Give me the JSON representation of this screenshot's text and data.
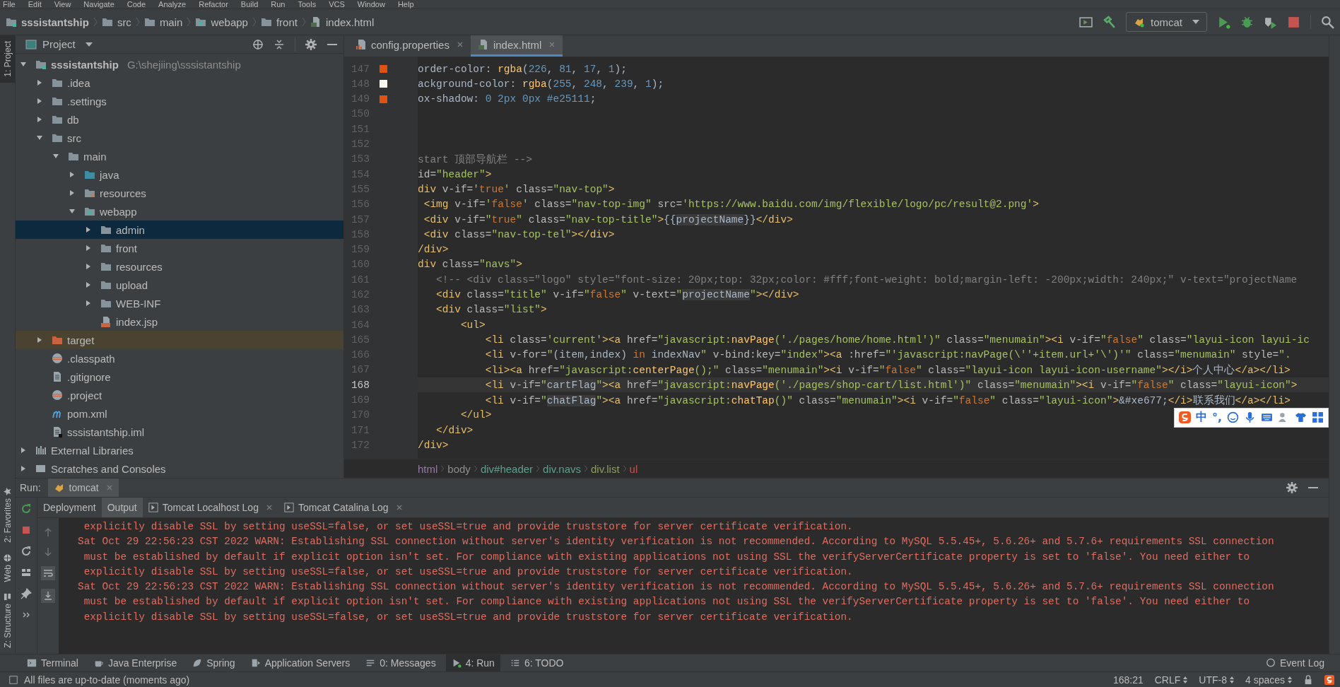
{
  "menu": [
    "File",
    "Edit",
    "View",
    "Navigate",
    "Code",
    "Analyze",
    "Refactor",
    "Build",
    "Run",
    "Tools",
    "VCS",
    "Window",
    "Help"
  ],
  "nav_bar": {
    "crumbs": [
      {
        "label": "sssistantship",
        "kind": "project"
      },
      {
        "label": "src",
        "kind": "folder"
      },
      {
        "label": "main",
        "kind": "folder"
      },
      {
        "label": "webapp",
        "kind": "folder-web"
      },
      {
        "label": "front",
        "kind": "folder"
      },
      {
        "label": "index.html",
        "kind": "file-html"
      }
    ],
    "run_config": "tomcat"
  },
  "side_stripe": {
    "top": [
      {
        "label": "1: Project",
        "selected": true
      }
    ],
    "bottom": [
      {
        "label": "2: Favorites",
        "selected": false,
        "kind": "favorites"
      },
      {
        "label": "Web",
        "selected": false,
        "kind": "web"
      },
      {
        "label": "Z: Structure",
        "selected": false,
        "kind": "structure"
      }
    ]
  },
  "project_panel": {
    "title": "Project",
    "tree": [
      {
        "label": "sssistantship",
        "path": "G:\\shejiing\\sssistantship",
        "kind": "project",
        "expanded": true,
        "selected": false,
        "children": [
          {
            "label": ".idea",
            "kind": "folder",
            "expanded": false,
            "selected": false
          },
          {
            "label": ".settings",
            "kind": "folder",
            "expanded": false,
            "selected": false
          },
          {
            "label": "db",
            "kind": "folder",
            "expanded": false,
            "selected": false
          },
          {
            "label": "src",
            "kind": "folder",
            "expanded": true,
            "selected": false,
            "children": [
              {
                "label": "main",
                "kind": "folder",
                "expanded": true,
                "selected": false,
                "children": [
                  {
                    "label": "java",
                    "kind": "folder-src",
                    "expanded": false,
                    "selected": false
                  },
                  {
                    "label": "resources",
                    "kind": "folder-res",
                    "expanded": false,
                    "selected": false
                  },
                  {
                    "label": "webapp",
                    "kind": "folder-web",
                    "expanded": true,
                    "selected": false,
                    "children": [
                      {
                        "label": "admin",
                        "kind": "folder",
                        "expanded": false,
                        "selected": true
                      },
                      {
                        "label": "front",
                        "kind": "folder",
                        "expanded": false,
                        "selected": false
                      },
                      {
                        "label": "resources",
                        "kind": "folder",
                        "expanded": false,
                        "selected": false
                      },
                      {
                        "label": "upload",
                        "kind": "folder",
                        "expanded": false,
                        "selected": false
                      },
                      {
                        "label": "WEB-INF",
                        "kind": "folder",
                        "expanded": false,
                        "selected": false
                      },
                      {
                        "label": "index.jsp",
                        "kind": "file-jsp",
                        "selected": false
                      }
                    ]
                  }
                ]
              }
            ]
          },
          {
            "label": "target",
            "kind": "folder-excluded",
            "expanded": false,
            "selected": false
          },
          {
            "label": ".classpath",
            "kind": "file-eclipse",
            "selected": false
          },
          {
            "label": ".gitignore",
            "kind": "file-text",
            "selected": false
          },
          {
            "label": ".project",
            "kind": "file-eclipse",
            "selected": false
          },
          {
            "label": "pom.xml",
            "kind": "file-maven",
            "selected": false
          },
          {
            "label": "sssistantship.iml",
            "kind": "file-iml",
            "selected": false
          }
        ]
      },
      {
        "label": "External Libraries",
        "kind": "libraries",
        "expanded": false,
        "selected": false
      },
      {
        "label": "Scratches and Consoles",
        "kind": "scratches",
        "expanded": false,
        "selected": false
      }
    ]
  },
  "editor": {
    "tabs": [
      {
        "label": "config.properties",
        "kind": "properties",
        "selected": false
      },
      {
        "label": "index.html",
        "kind": "html",
        "selected": true
      }
    ],
    "lines": [
      {
        "number": "147",
        "current": false,
        "color": "#e25111",
        "segments": [
          {
            "kind": "plain",
            "text": "order-color: "
          },
          {
            "kind": "fn",
            "text": "rgba"
          },
          {
            "kind": "plain",
            "text": "("
          },
          {
            "kind": "num",
            "text": "226"
          },
          {
            "kind": "plain",
            "text": ", "
          },
          {
            "kind": "num",
            "text": "81"
          },
          {
            "kind": "plain",
            "text": ", "
          },
          {
            "kind": "num",
            "text": "17"
          },
          {
            "kind": "plain",
            "text": ", "
          },
          {
            "kind": "num",
            "text": "1"
          },
          {
            "kind": "plain",
            "text": ");"
          }
        ]
      },
      {
        "number": "148",
        "current": false,
        "color": "#fff8ef",
        "segments": [
          {
            "kind": "plain",
            "text": "ackground-color: "
          },
          {
            "kind": "fn",
            "text": "rgba"
          },
          {
            "kind": "plain",
            "text": "("
          },
          {
            "kind": "num",
            "text": "255"
          },
          {
            "kind": "plain",
            "text": ", "
          },
          {
            "kind": "num",
            "text": "248"
          },
          {
            "kind": "plain",
            "text": ", "
          },
          {
            "kind": "num",
            "text": "239"
          },
          {
            "kind": "plain",
            "text": ", "
          },
          {
            "kind": "num",
            "text": "1"
          },
          {
            "kind": "plain",
            "text": ");"
          }
        ]
      },
      {
        "number": "149",
        "current": false,
        "color": "#e25111",
        "segments": [
          {
            "kind": "plain",
            "text": "ox-shadow: "
          },
          {
            "kind": "num",
            "text": "0 2px 0px #e25111"
          },
          {
            "kind": "plain",
            "text": ";"
          }
        ]
      },
      {
        "number": "150",
        "current": false
      },
      {
        "number": "151",
        "current": false
      },
      {
        "number": "152",
        "current": false
      },
      {
        "number": "153",
        "current": false,
        "segments": [
          {
            "kind": "comment",
            "text": "start 顶部导航栏 -->"
          }
        ]
      },
      {
        "number": "154",
        "current": false,
        "segments": [
          {
            "kind": "attr",
            "text": "id="
          },
          {
            "kind": "value",
            "text": "\"header\""
          },
          {
            "kind": "tag",
            "text": ">"
          }
        ]
      },
      {
        "number": "155",
        "current": false,
        "segments": [
          {
            "kind": "tag",
            "text": "div"
          },
          {
            "kind": "attr",
            "text": " v-if="
          },
          {
            "kind": "value",
            "text": "'"
          },
          {
            "kind": "kw",
            "text": "true"
          },
          {
            "kind": "value",
            "text": "'"
          },
          {
            "kind": "attr",
            "text": " class="
          },
          {
            "kind": "value",
            "text": "\"nav-top\""
          },
          {
            "kind": "tag",
            "text": ">"
          }
        ]
      },
      {
        "number": "156",
        "current": false,
        "segments": [
          {
            "kind": "tag",
            "text": " <img"
          },
          {
            "kind": "attr",
            "text": " v-if="
          },
          {
            "kind": "value",
            "text": "'"
          },
          {
            "kind": "kw",
            "text": "false"
          },
          {
            "kind": "value",
            "text": "'"
          },
          {
            "kind": "attr",
            "text": " class="
          },
          {
            "kind": "value",
            "text": "\"nav-top-img\""
          },
          {
            "kind": "attr",
            "text": " src="
          },
          {
            "kind": "value",
            "text": "'https://www.baidu.com/img/flexible/logo/pc/result@2.png'"
          },
          {
            "kind": "tag",
            "text": ">"
          }
        ]
      },
      {
        "number": "157",
        "current": false,
        "segments": [
          {
            "kind": "tag",
            "text": " <div"
          },
          {
            "kind": "attr",
            "text": " v-if="
          },
          {
            "kind": "value",
            "text": "\""
          },
          {
            "kind": "kw",
            "text": "true"
          },
          {
            "kind": "value",
            "text": "\""
          },
          {
            "kind": "attr",
            "text": " class="
          },
          {
            "kind": "value",
            "text": "\"nav-top-title\""
          },
          {
            "kind": "tag",
            "text": ">"
          },
          {
            "kind": "plain",
            "text": "{{"
          },
          {
            "kind": "var",
            "text": "projectName"
          },
          {
            "kind": "plain",
            "text": "}}"
          },
          {
            "kind": "tag",
            "text": "</div>"
          }
        ]
      },
      {
        "number": "158",
        "current": false,
        "segments": [
          {
            "kind": "tag",
            "text": " <div"
          },
          {
            "kind": "attr",
            "text": " class="
          },
          {
            "kind": "value",
            "text": "\"nav-top-tel\""
          },
          {
            "kind": "tag",
            "text": "></div>"
          }
        ]
      },
      {
        "number": "159",
        "current": false,
        "segments": [
          {
            "kind": "tag",
            "text": "/div>"
          }
        ]
      },
      {
        "number": "160",
        "current": false,
        "segments": [
          {
            "kind": "tag",
            "text": "div"
          },
          {
            "kind": "attr",
            "text": " class="
          },
          {
            "kind": "value",
            "text": "\"navs\""
          },
          {
            "kind": "tag",
            "text": ">"
          }
        ]
      },
      {
        "number": "161",
        "current": false,
        "segments": [
          {
            "kind": "comment",
            "text": "   <!-- <div class=\"logo\" style=\"font-size: 20px;top: 32px;color: #fff;font-weight: bold;margin-left: -200px;width: 240px;\" v-text=\"projectName"
          }
        ]
      },
      {
        "number": "162",
        "current": false,
        "segments": [
          {
            "kind": "tag",
            "text": "   <div"
          },
          {
            "kind": "attr",
            "text": " class="
          },
          {
            "kind": "value",
            "text": "\"title\""
          },
          {
            "kind": "attr",
            "text": " v-if="
          },
          {
            "kind": "value",
            "text": "\""
          },
          {
            "kind": "kw",
            "text": "false"
          },
          {
            "kind": "value",
            "text": "\""
          },
          {
            "kind": "attr",
            "text": " v-text="
          },
          {
            "kind": "value",
            "text": "\""
          },
          {
            "kind": "var",
            "text": "projectName"
          },
          {
            "kind": "value",
            "text": "\""
          },
          {
            "kind": "tag",
            "text": "></div>"
          }
        ]
      },
      {
        "number": "163",
        "current": false,
        "segments": [
          {
            "kind": "tag",
            "text": "   <div"
          },
          {
            "kind": "attr",
            "text": " class="
          },
          {
            "kind": "value",
            "text": "\"list\""
          },
          {
            "kind": "tag",
            "text": ">"
          }
        ]
      },
      {
        "number": "164",
        "current": false,
        "segments": [
          {
            "kind": "tag",
            "text": "       <ul>"
          }
        ]
      },
      {
        "number": "165",
        "current": false,
        "segments": [
          {
            "kind": "tag",
            "text": "           <li"
          },
          {
            "kind": "attr",
            "text": " class="
          },
          {
            "kind": "value",
            "text": "'current'"
          },
          {
            "kind": "tag",
            "text": "><a"
          },
          {
            "kind": "attr",
            "text": " href="
          },
          {
            "kind": "value",
            "text": "\"javascript:"
          },
          {
            "kind": "fn",
            "text": "navPage"
          },
          {
            "kind": "value",
            "text": "('./pages/home/home.html')\""
          },
          {
            "kind": "attr",
            "text": " class="
          },
          {
            "kind": "value",
            "text": "\"menumain\""
          },
          {
            "kind": "tag",
            "text": "><i"
          },
          {
            "kind": "attr",
            "text": " v-if="
          },
          {
            "kind": "value",
            "text": "\""
          },
          {
            "kind": "kw",
            "text": "false"
          },
          {
            "kind": "value",
            "text": "\""
          },
          {
            "kind": "attr",
            "text": " class="
          },
          {
            "kind": "value",
            "text": "\"layui-icon layui-ic"
          }
        ]
      },
      {
        "number": "166",
        "current": false,
        "segments": [
          {
            "kind": "tag",
            "text": "           <li"
          },
          {
            "kind": "attr",
            "text": " v-for="
          },
          {
            "kind": "value",
            "text": "\""
          },
          {
            "kind": "plain",
            "text": "(item,index) "
          },
          {
            "kind": "kw",
            "text": "in"
          },
          {
            "kind": "plain",
            "text": " indexNav"
          },
          {
            "kind": "value",
            "text": "\""
          },
          {
            "kind": "attr",
            "text": " v-bind:key="
          },
          {
            "kind": "value",
            "text": "\"index\""
          },
          {
            "kind": "tag",
            "text": "><a"
          },
          {
            "kind": "attr",
            "text": " :href="
          },
          {
            "kind": "value",
            "text": "\"'javascript:navPage(\\''+item.url+'\\')'\""
          },
          {
            "kind": "attr",
            "text": " class="
          },
          {
            "kind": "value",
            "text": "\"menumain\""
          },
          {
            "kind": "attr",
            "text": " style="
          },
          {
            "kind": "value",
            "text": "\"."
          }
        ]
      },
      {
        "number": "167",
        "current": false,
        "segments": [
          {
            "kind": "tag",
            "text": "           <li><a"
          },
          {
            "kind": "attr",
            "text": " href="
          },
          {
            "kind": "value",
            "text": "\"javascript:"
          },
          {
            "kind": "fn",
            "text": "centerPage"
          },
          {
            "kind": "value",
            "text": "();\""
          },
          {
            "kind": "attr",
            "text": " class="
          },
          {
            "kind": "value",
            "text": "\"menumain\""
          },
          {
            "kind": "tag",
            "text": "><i"
          },
          {
            "kind": "attr",
            "text": " v-if="
          },
          {
            "kind": "value",
            "text": "\""
          },
          {
            "kind": "kw",
            "text": "false"
          },
          {
            "kind": "value",
            "text": "\""
          },
          {
            "kind": "attr",
            "text": " class="
          },
          {
            "kind": "value",
            "text": "\"layui-icon layui-icon-username\""
          },
          {
            "kind": "tag",
            "text": "></i>"
          },
          {
            "kind": "plain",
            "text": "个人中心"
          },
          {
            "kind": "tag",
            "text": "</a></li>"
          }
        ]
      },
      {
        "number": "168",
        "current": true,
        "segments": [
          {
            "kind": "tag",
            "text": "           <li"
          },
          {
            "kind": "attr",
            "text": " v-if="
          },
          {
            "kind": "value",
            "text": "\""
          },
          {
            "kind": "var",
            "text": "cartFlag"
          },
          {
            "kind": "value",
            "text": "\""
          },
          {
            "kind": "tag",
            "text": "><a"
          },
          {
            "kind": "attr",
            "text": " href="
          },
          {
            "kind": "value",
            "text": "\"javascript:"
          },
          {
            "kind": "fn",
            "text": "navPage"
          },
          {
            "kind": "value",
            "text": "('./pages/shop-cart/list.html')\""
          },
          {
            "kind": "attr",
            "text": " class="
          },
          {
            "kind": "value",
            "text": "\"menumain\""
          },
          {
            "kind": "tag",
            "text": "><i"
          },
          {
            "kind": "attr",
            "text": " v-if="
          },
          {
            "kind": "value",
            "text": "\""
          },
          {
            "kind": "kw",
            "text": "false"
          },
          {
            "kind": "value",
            "text": "\""
          },
          {
            "kind": "attr",
            "text": " class="
          },
          {
            "kind": "value",
            "text": "\"layui-icon\""
          },
          {
            "kind": "tag",
            "text": ">"
          }
        ]
      },
      {
        "number": "169",
        "current": false,
        "segments": [
          {
            "kind": "tag",
            "text": "           <li"
          },
          {
            "kind": "attr",
            "text": " v-if="
          },
          {
            "kind": "value",
            "text": "\""
          },
          {
            "kind": "var",
            "text": "chatFlag"
          },
          {
            "kind": "value",
            "text": "\""
          },
          {
            "kind": "tag",
            "text": "><a"
          },
          {
            "kind": "attr",
            "text": " href="
          },
          {
            "kind": "value",
            "text": "\"javascript:"
          },
          {
            "kind": "fn",
            "text": "chatTap"
          },
          {
            "kind": "value",
            "text": "()\""
          },
          {
            "kind": "attr",
            "text": " class="
          },
          {
            "kind": "value",
            "text": "\"menumain\""
          },
          {
            "kind": "tag",
            "text": "><i"
          },
          {
            "kind": "attr",
            "text": " v-if="
          },
          {
            "kind": "value",
            "text": "\""
          },
          {
            "kind": "kw",
            "text": "false"
          },
          {
            "kind": "value",
            "text": "\""
          },
          {
            "kind": "attr",
            "text": " class="
          },
          {
            "kind": "value",
            "text": "\"layui-icon\""
          },
          {
            "kind": "tag",
            "text": ">"
          },
          {
            "kind": "plain",
            "text": "&#xe677;"
          },
          {
            "kind": "tag",
            "text": "</i>"
          },
          {
            "kind": "plain",
            "text": "联系我们"
          },
          {
            "kind": "tag",
            "text": "</a></li>"
          }
        ]
      },
      {
        "number": "170",
        "current": false,
        "segments": [
          {
            "kind": "tag",
            "text": "       </ul>"
          }
        ]
      },
      {
        "number": "171",
        "current": false,
        "segments": [
          {
            "kind": "tag",
            "text": "   </div>"
          }
        ]
      },
      {
        "number": "172",
        "current": false,
        "segments": [
          {
            "kind": "tag",
            "text": "/div>"
          }
        ]
      }
    ],
    "breadcrumbs": [
      {
        "label": "html",
        "color": "#9876aa"
      },
      {
        "label": "body",
        "color": "#8c8c8c"
      },
      {
        "label": "div#header",
        "color": "#5f9e8f"
      },
      {
        "label": "div.navs",
        "color": "#5f9e8f"
      },
      {
        "label": "div.list",
        "color": "#8f9e5f"
      },
      {
        "label": "ul",
        "color": "#c75450"
      }
    ],
    "ime_bar": {
      "mode": "中",
      "punctuation": "°,"
    }
  },
  "run_panel": {
    "label": "Run:",
    "tabs": [
      {
        "label": "tomcat",
        "selected": true
      }
    ],
    "subtabs": [
      {
        "label": "Deployment",
        "selected": false,
        "kind": "plain"
      },
      {
        "label": "Output",
        "selected": true,
        "kind": "plain"
      },
      {
        "label": "Tomcat Localhost Log",
        "selected": false,
        "kind": "log"
      },
      {
        "label": "Tomcat Catalina Log",
        "selected": false,
        "kind": "log"
      }
    ],
    "console": [
      " explicitly disable SSL by setting useSSL=false, or set useSSL=true and provide truststore for server certificate verification.",
      "Sat Oct 29 22:56:23 CST 2022 WARN: Establishing SSL connection without server's identity verification is not recommended. According to MySQL 5.5.45+, 5.6.26+ and 5.7.6+ requirements SSL connection",
      " must be established by default if explicit option isn't set. For compliance with existing applications not using SSL the verifyServerCertificate property is set to 'false'. You need either to",
      " explicitly disable SSL by setting useSSL=false, or set useSSL=true and provide truststore for server certificate verification.",
      "Sat Oct 29 22:56:23 CST 2022 WARN: Establishing SSL connection without server's identity verification is not recommended. According to MySQL 5.5.45+, 5.6.26+ and 5.7.6+ requirements SSL connection",
      " must be established by default if explicit option isn't set. For compliance with existing applications not using SSL the verifyServerCertificate property is set to 'false'. You need either to",
      " explicitly disable SSL by setting useSSL=false, or set useSSL=true and provide truststore for server certificate verification."
    ]
  },
  "tool_tabs": [
    {
      "label": "Terminal",
      "kind": "terminal",
      "selected": false
    },
    {
      "label": "Java Enterprise",
      "kind": "enterprise",
      "selected": false
    },
    {
      "label": "Spring",
      "kind": "spring",
      "selected": false
    },
    {
      "label": "Application Servers",
      "kind": "servers",
      "selected": false
    },
    {
      "label": "0: Messages",
      "kind": "messages",
      "selected": false
    },
    {
      "label": "4: Run",
      "kind": "run",
      "selected": true
    },
    {
      "label": "6: TODO",
      "kind": "todo",
      "selected": false
    }
  ],
  "event_log": "Event Log",
  "status_bar": {
    "message": "All files are up-to-date (moments ago)",
    "position": "168:21",
    "line_ending": "CRLF",
    "encoding": "UTF-8",
    "indent": "4 spaces"
  }
}
